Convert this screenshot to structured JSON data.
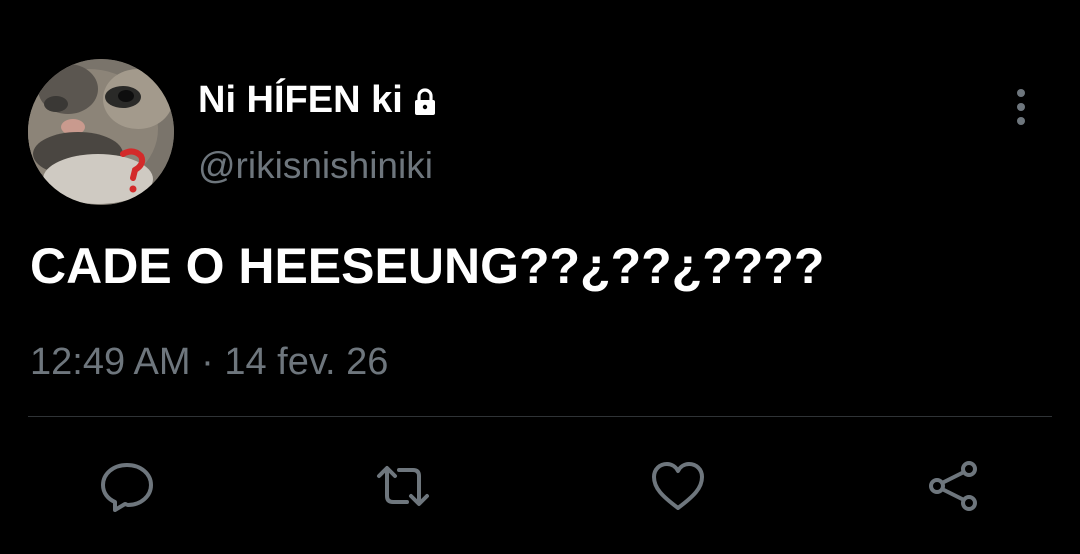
{
  "user": {
    "display_name": "Ni HÍFEN ki",
    "handle": "@rikisnishiniki",
    "protected_icon": "lock-icon",
    "avatar": "cat-avatar"
  },
  "tweet": {
    "text": "CADE O HEESEUNG??¿??¿????",
    "timestamp": "12:49 AM · 14 fev. 26"
  },
  "actions": [
    {
      "name": "reply",
      "icon": "speech-bubble-icon"
    },
    {
      "name": "retweet",
      "icon": "retweet-icon"
    },
    {
      "name": "like",
      "icon": "heart-icon"
    },
    {
      "name": "share",
      "icon": "share-icon"
    }
  ],
  "colors": {
    "background": "#000000",
    "primary_text": "#ffffff",
    "secondary_text": "#6e767d",
    "divider": "#2f3336"
  }
}
